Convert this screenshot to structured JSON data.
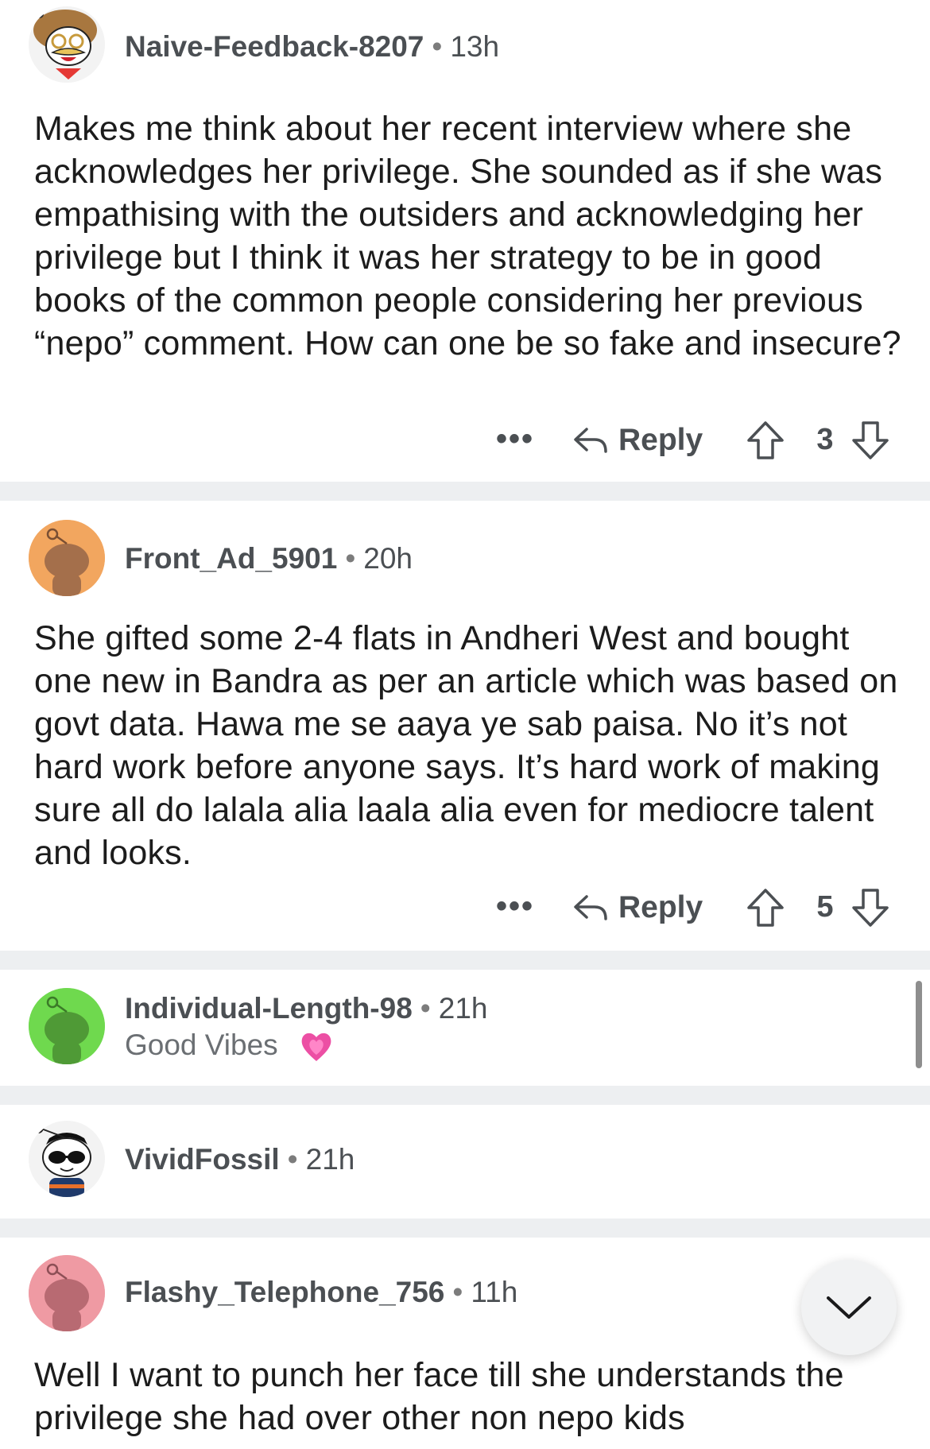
{
  "comments": [
    {
      "username": "Naive-Feedback-8207",
      "time": "13h",
      "body": "Makes me think about her recent interview where she acknowledges her privilege. She sounded as if she was empathising with the outsiders and acknowledging her privilege but I think it was her strategy to be in good books of the common people considering her previous “nepo” comment. How can one be so fake and insecure?",
      "more": "•••",
      "reply_label": "Reply",
      "score": "3"
    },
    {
      "username": "Front_Ad_5901",
      "time": "20h",
      "body": "She gifted some 2-4 flats in Andheri West and bought one new in Bandra as per an article which was based on govt data. Hawa me se aaya ye sab paisa. No it’s not hard work before anyone says. It’s hard work of making sure all do lalala alia laala alia even for mediocre talent and looks.",
      "more": "•••",
      "reply_label": "Reply",
      "score": "5"
    },
    {
      "username": "Individual-Length-98",
      "time": "21h",
      "flair": "Good Vibes"
    },
    {
      "username": "VividFossil",
      "time": "21h"
    },
    {
      "username": "Flashy_Telephone_756",
      "time": "11h",
      "body": "Well I want to punch her face till she understands the privilege she had over other non nepo kids"
    }
  ],
  "separator": "•",
  "colors": {
    "divider": "#edeff1",
    "meta_text": "#4b4f53",
    "avatar_orange": "#f2a65f",
    "avatar_green": "#6fd94e",
    "avatar_pink": "#ef9aa3"
  },
  "icons": [
    "reply-arrow-icon",
    "upvote-icon",
    "downvote-icon",
    "more-options-icon",
    "heart-icon",
    "chevron-down-icon"
  ]
}
